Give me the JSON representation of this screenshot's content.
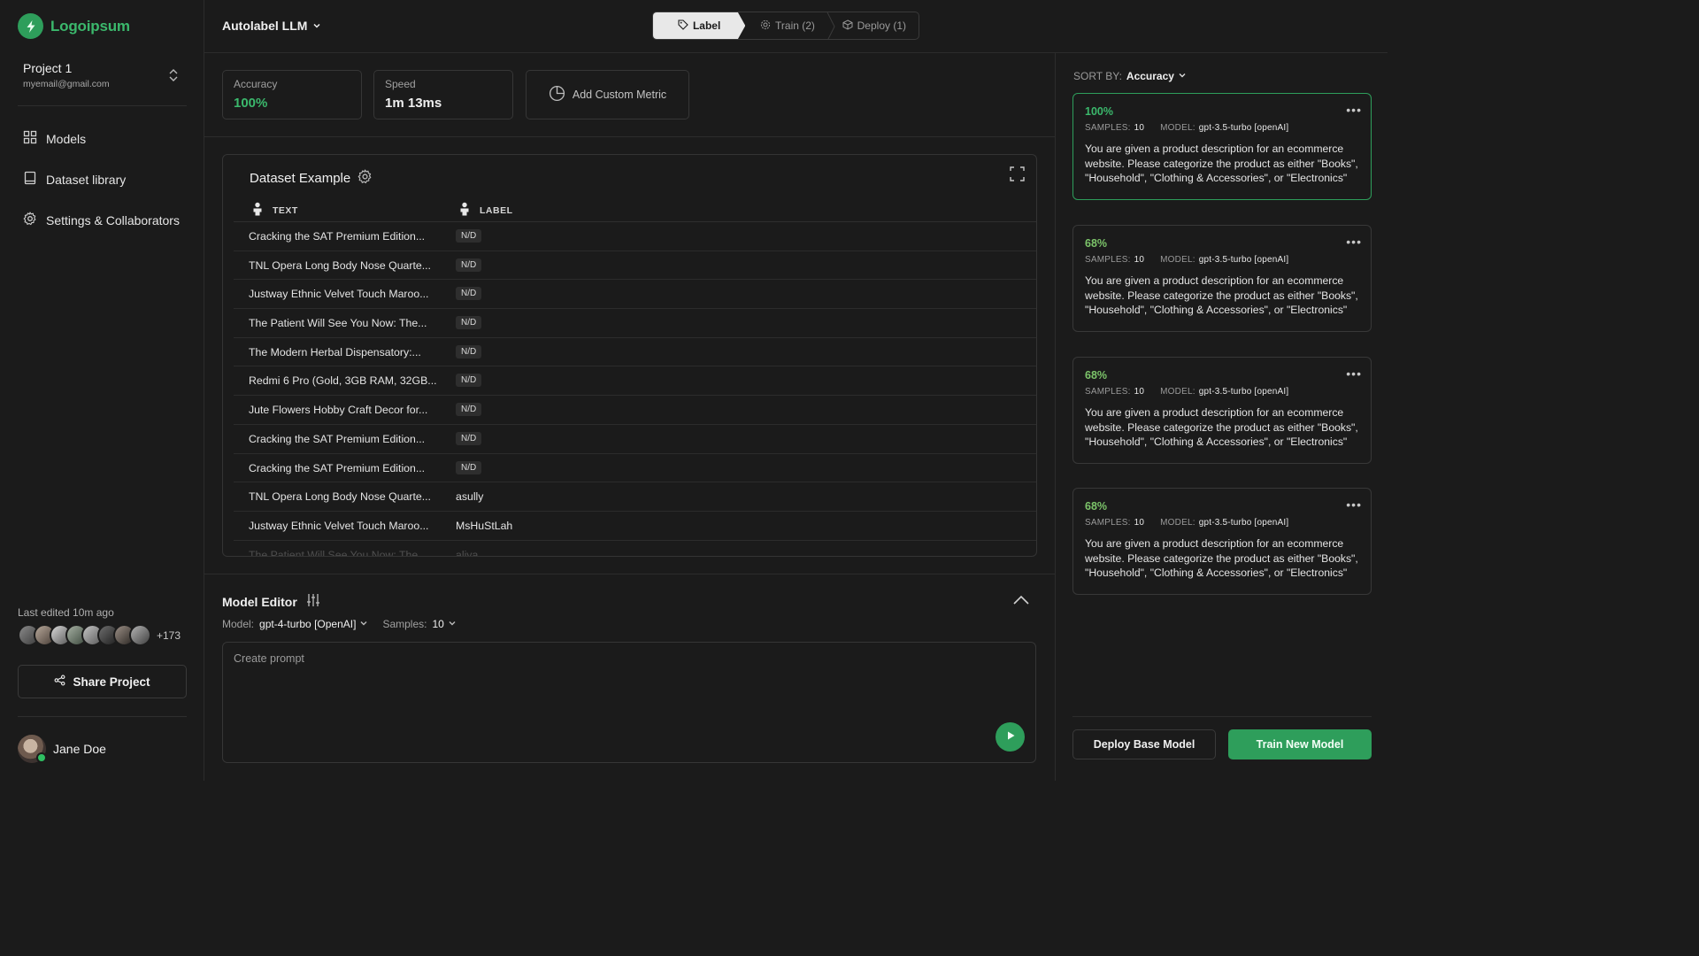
{
  "colors": {
    "accent": "#2e9e5b",
    "accent_text": "#3bb86c",
    "score_high": "#3bb86c",
    "score_mid": "#7cc46a"
  },
  "brand": {
    "name": "Logoipsum"
  },
  "project": {
    "name": "Project 1",
    "email": "myemail@gmail.com"
  },
  "sidebar": {
    "items": [
      {
        "label": "Models",
        "icon": "grid-icon"
      },
      {
        "label": "Dataset library",
        "icon": "book-icon"
      },
      {
        "label": "Settings & Collaborators",
        "icon": "gear-icon"
      }
    ],
    "last_edited": "Last edited 10m ago",
    "more_collaborators": "+173",
    "share_label": "Share Project",
    "user_name": "Jane Doe"
  },
  "header": {
    "title": "Autolabel LLM",
    "steps": [
      {
        "label": "Label",
        "icon": "tag-icon",
        "active": true
      },
      {
        "label": "Train (2)",
        "icon": "gear-icon",
        "active": false
      },
      {
        "label": "Deploy (1)",
        "icon": "package-icon",
        "active": false
      }
    ]
  },
  "metrics": {
    "accuracy": {
      "label": "Accuracy",
      "value": "100%"
    },
    "speed": {
      "label": "Speed",
      "value": "1m 13ms"
    },
    "add_label": "Add Custom Metric"
  },
  "dataset": {
    "title": "Dataset Example",
    "columns": {
      "text": "TEXT",
      "label": "LABEL"
    },
    "rows": [
      {
        "text": "Cracking the SAT Premium Edition...",
        "label": "N/D",
        "badge": true
      },
      {
        "text": "TNL Opera Long Body Nose Quarte...",
        "label": "N/D",
        "badge": true
      },
      {
        "text": "Justway Ethnic Velvet Touch Maroo...",
        "label": "N/D",
        "badge": true
      },
      {
        "text": "The Patient Will See You Now: The...",
        "label": "N/D",
        "badge": true
      },
      {
        "text": "The Modern Herbal Dispensatory:...",
        "label": "N/D",
        "badge": true
      },
      {
        "text": "Redmi 6 Pro (Gold, 3GB RAM, 32GB...",
        "label": "N/D",
        "badge": true
      },
      {
        "text": "Jute Flowers Hobby Craft Decor for...",
        "label": "N/D",
        "badge": true
      },
      {
        "text": "Cracking the SAT Premium Edition...",
        "label": "N/D",
        "badge": true
      },
      {
        "text": "Cracking the SAT Premium Edition...",
        "label": "N/D",
        "badge": true
      },
      {
        "text": "TNL Opera Long Body Nose Quarte...",
        "label": "asully",
        "badge": false
      },
      {
        "text": "Justway Ethnic Velvet Touch Maroo...",
        "label": "MsHuStLah",
        "badge": false
      },
      {
        "text": "The Patient Will See You Now: The...",
        "label": "aliya",
        "badge": false
      }
    ]
  },
  "editor": {
    "title": "Model Editor",
    "model_label": "Model:",
    "model_value": "gpt-4-turbo [OpenAI]",
    "samples_label": "Samples:",
    "samples_value": "10",
    "prompt_placeholder": "Create prompt",
    "prompt_value": ""
  },
  "right": {
    "sort_label": "SORT BY:",
    "sort_value": "Accuracy",
    "cards": [
      {
        "score": "100%",
        "samples_label": "SAMPLES:",
        "samples": "10",
        "model_label": "MODEL:",
        "model": "gpt-3.5-turbo [openAI]",
        "text": "You are given a product description for an ecommerce website. Please categorize the product as either \"Books\", \"Household\", \"Clothing & Accessories\", or \"Electronics\""
      },
      {
        "score": "68%",
        "samples_label": "SAMPLES:",
        "samples": "10",
        "model_label": "MODEL:",
        "model": "gpt-3.5-turbo [openAI]",
        "text": "You are given a product description for an ecommerce website. Please categorize the product as either \"Books\", \"Household\", \"Clothing & Accessories\", or \"Electronics\""
      },
      {
        "score": "68%",
        "samples_label": "SAMPLES:",
        "samples": "10",
        "model_label": "MODEL:",
        "model": "gpt-3.5-turbo [openAI]",
        "text": "You are given a product description for an ecommerce website. Please categorize the product as either \"Books\", \"Household\", \"Clothing & Accessories\", or \"Electronics\""
      },
      {
        "score": "68%",
        "samples_label": "SAMPLES:",
        "samples": "10",
        "model_label": "MODEL:",
        "model": "gpt-3.5-turbo [openAI]",
        "text": "You are given a product description for an ecommerce website. Please categorize the product as either \"Books\", \"Household\", \"Clothing & Accessories\", or \"Electronics\""
      }
    ],
    "deploy_label": "Deploy Base Model",
    "train_label": "Train New Model"
  }
}
